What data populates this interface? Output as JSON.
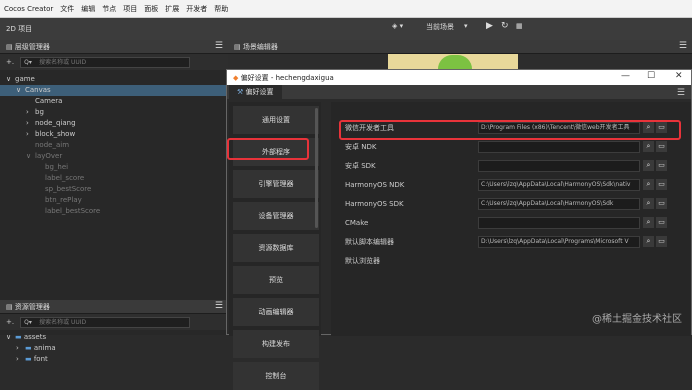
{
  "menubar": {
    "items": [
      "Cocos Creator",
      "文件",
      "编辑",
      "节点",
      "项目",
      "面板",
      "扩展",
      "开发者",
      "帮助"
    ]
  },
  "toolbar": {
    "project_label": "2D 项目",
    "scene_label": "当前场景"
  },
  "hierarchy": {
    "title": "层级管理器",
    "search_placeholder": "搜索名称或 UUID",
    "nodes": [
      {
        "label": "game",
        "indent": 0,
        "arrow": "∨"
      },
      {
        "label": "Canvas",
        "indent": 1,
        "arrow": "∨",
        "selected": true
      },
      {
        "label": "Camera",
        "indent": 2,
        "arrow": ""
      },
      {
        "label": "bg",
        "indent": 2,
        "arrow": "›"
      },
      {
        "label": "node_qiang",
        "indent": 2,
        "arrow": "›"
      },
      {
        "label": "block_show",
        "indent": 2,
        "arrow": "›"
      },
      {
        "label": "node_aim",
        "indent": 2,
        "arrow": "",
        "dim": true
      },
      {
        "label": "layOver",
        "indent": 2,
        "arrow": "∨",
        "dim": true
      },
      {
        "label": "bg_hei",
        "indent": 3,
        "arrow": "",
        "dim": true
      },
      {
        "label": "label_score",
        "indent": 3,
        "arrow": "",
        "dim": true
      },
      {
        "label": "sp_bestScore",
        "indent": 3,
        "arrow": "",
        "dim": true
      },
      {
        "label": "btn_rePlay",
        "indent": 3,
        "arrow": "",
        "dim": true
      },
      {
        "label": "label_bestScore",
        "indent": 3,
        "arrow": "",
        "dim": true
      }
    ]
  },
  "assets": {
    "title": "资源管理器",
    "search_placeholder": "搜索名称或 UUID",
    "nodes": [
      {
        "label": "assets",
        "indent": 0,
        "arrow": "∨"
      },
      {
        "label": "anima",
        "indent": 1,
        "arrow": "›"
      },
      {
        "label": "font",
        "indent": 1,
        "arrow": "›"
      }
    ]
  },
  "scene_editor": {
    "title": "场景编辑器"
  },
  "dialog": {
    "title": "偏好设置 - hechengdaxigua",
    "tab": "偏好设置",
    "sidebar": [
      "通用设置",
      "外部程序",
      "引擎管理器",
      "设备管理器",
      "资源数据库",
      "预览",
      "动画编辑器",
      "构建发布",
      "控制台"
    ],
    "rows": [
      {
        "label": "微信开发者工具",
        "value": "D:\\Program Files (x86)\\Tencent\\微信web开发者工具",
        "has_field": true
      },
      {
        "label": "安卓 NDK",
        "value": "",
        "has_field": true
      },
      {
        "label": "安卓 SDK",
        "value": "",
        "has_field": true
      },
      {
        "label": "HarmonyOS NDK",
        "value": "C:\\Users\\lzq\\AppData\\Local\\HarmonyOS\\Sdk\\nativ",
        "has_field": true
      },
      {
        "label": "HarmonyOS SDK",
        "value": "C:\\Users\\lzq\\AppData\\Local\\HarmonyOS\\Sdk",
        "has_field": true
      },
      {
        "label": "CMake",
        "value": "",
        "has_field": true
      },
      {
        "label": "默认脚本编辑器",
        "value": "D:\\Users\\lzq\\AppData\\Local\\Programs\\Microsoft V",
        "has_field": true
      },
      {
        "label": "默认浏览器",
        "value": "",
        "has_field": false
      }
    ]
  },
  "watermark": "@稀土掘金技术社区",
  "colors": {
    "highlight": "#e8333a",
    "selected": "#3d5f79"
  }
}
